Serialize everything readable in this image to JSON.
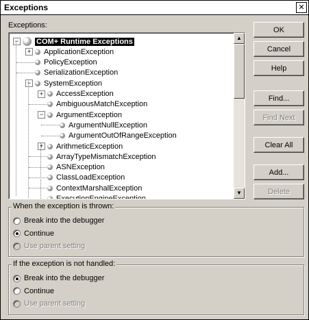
{
  "window": {
    "title": "Exceptions",
    "close_glyph": "✕"
  },
  "tree_label": "Exceptions:",
  "tree": [
    {
      "label": "COM+ Runtime Exceptions",
      "level": 0,
      "expander": "minus",
      "selected": true,
      "root": true
    },
    {
      "label": "ApplicationException",
      "level": 1,
      "expander": "plus"
    },
    {
      "label": "PolicyException",
      "level": 1,
      "expander": null
    },
    {
      "label": "SerializationException",
      "level": 1,
      "expander": null
    },
    {
      "label": "SystemException",
      "level": 1,
      "expander": "minus"
    },
    {
      "label": "AccessException",
      "level": 2,
      "expander": "plus"
    },
    {
      "label": "AmbiguousMatchException",
      "level": 2,
      "expander": null
    },
    {
      "label": "ArgumentException",
      "level": 2,
      "expander": "minus"
    },
    {
      "label": "ArgumentNullException",
      "level": 3,
      "expander": null
    },
    {
      "label": "ArgumentOutOfRangeException",
      "level": 3,
      "expander": null
    },
    {
      "label": "ArithmeticException",
      "level": 2,
      "expander": "plus"
    },
    {
      "label": "ArrayTypeMismatchException",
      "level": 2,
      "expander": null
    },
    {
      "label": "ASNException",
      "level": 2,
      "expander": null
    },
    {
      "label": "ClassLoadException",
      "level": 2,
      "expander": null
    },
    {
      "label": "ContextMarshalException",
      "level": 2,
      "expander": null
    },
    {
      "label": "ExecutionEngineException",
      "level": 2,
      "expander": null
    }
  ],
  "buttons": {
    "ok": "OK",
    "cancel": "Cancel",
    "help": "Help",
    "find": "Find...",
    "find_next": "Find Next",
    "clear_all": "Clear All",
    "add": "Add...",
    "delete": "Delete"
  },
  "thrown_group": {
    "label": "When the exception is thrown:",
    "options": [
      {
        "label": "Break into the debugger",
        "checked": false,
        "disabled": false
      },
      {
        "label": "Continue",
        "checked": true,
        "disabled": false
      },
      {
        "label": "Use parent setting",
        "checked": false,
        "disabled": true
      }
    ]
  },
  "unhandled_group": {
    "label": "If the exception is not handled:",
    "options": [
      {
        "label": "Break into the debugger",
        "checked": true,
        "disabled": false
      },
      {
        "label": "Continue",
        "checked": false,
        "disabled": false
      },
      {
        "label": "Use parent setting",
        "checked": false,
        "disabled": true
      }
    ]
  },
  "scrollbar": {
    "up_glyph": "▲",
    "down_glyph": "▼"
  }
}
